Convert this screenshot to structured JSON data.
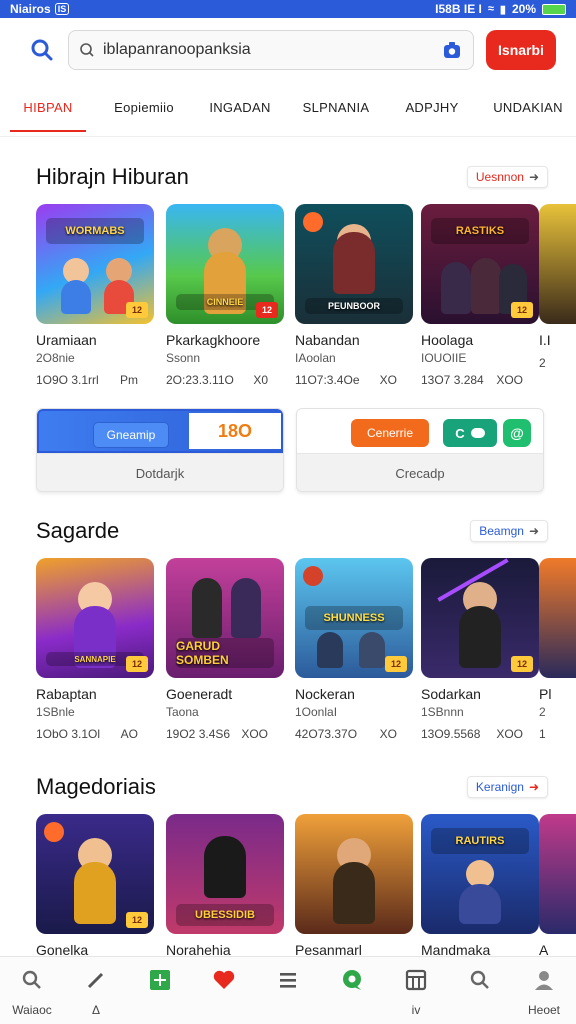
{
  "status_bar": {
    "left_text": "Niairos",
    "left_badge": "IS",
    "right_text": "I58B IE I",
    "battery_text": "20%"
  },
  "search": {
    "value": "iblapanranoopanksia",
    "button_label": "Isnarbi"
  },
  "tabs": [
    {
      "label": "HIBPAN",
      "active": true
    },
    {
      "label": "Eopiemiio",
      "active": false
    },
    {
      "label": "INGADAN",
      "active": false
    },
    {
      "label": "SLPNANIA",
      "active": false
    },
    {
      "label": "ADPJHY",
      "active": false
    },
    {
      "label": "UNDAKIAN",
      "active": false
    }
  ],
  "section1": {
    "title": "Hibrajn Hiburan",
    "see_all": "Uesnnon",
    "cards": [
      {
        "name": "Uramiaan",
        "sub": "2O8nie",
        "meta_left": "1O9O 3.1rrl",
        "meta_right": "Pm",
        "logo": "WORMABS",
        "badge": "12"
      },
      {
        "name": "Pkarkagkhoore",
        "sub": "Ssonn",
        "meta_left": "2O:23.3.11O",
        "meta_right": "X0",
        "logo": "CINNEIE",
        "badge": "12"
      },
      {
        "name": "Nabandan",
        "sub": "IAoolan",
        "meta_left": "11O7:3.4Oe",
        "meta_right": "XO",
        "logo": "PEUNBOOR",
        "badge": ""
      },
      {
        "name": "Hoolaga",
        "sub": "IOUOIIE",
        "meta_left": "13O7 3.284",
        "meta_right": "XOO",
        "logo": "RASTIKS",
        "badge": "12"
      },
      {
        "name": "I.I",
        "sub": "",
        "meta_left": "2",
        "meta_right": "",
        "logo": "",
        "badge": ""
      }
    ]
  },
  "promos": [
    {
      "button": "Gneamip",
      "value": "18O",
      "footer": "Dotdarjk"
    },
    {
      "button": "Cenerrie",
      "button2": "C",
      "icon": "@",
      "footer": "Crecadp"
    }
  ],
  "section2": {
    "title": "Sagarde",
    "see_all": "Beamgn",
    "cards": [
      {
        "name": "Rabaptan",
        "sub": "1SBnle",
        "meta_left": "1ObO 3.1Ol",
        "meta_right": "AO",
        "logo": "SANNAPIE",
        "badge": "12"
      },
      {
        "name": "Goeneradt",
        "sub": "Taona",
        "meta_left": "19O2 3.4S6",
        "meta_right": "XOO",
        "logo": "GARUD SOMBEN",
        "badge": ""
      },
      {
        "name": "Nockeran",
        "sub": "1OonlaI",
        "meta_left": "42O73.37O",
        "meta_right": "XO",
        "logo": "SHUNNESS",
        "badge": "12"
      },
      {
        "name": "Sodarkan",
        "sub": "1SBnnn",
        "meta_left": "13O9.5568",
        "meta_right": "XOO",
        "logo": "",
        "badge": "12"
      },
      {
        "name": "Pl",
        "sub": "2",
        "meta_left": "1",
        "meta_right": "",
        "logo": "",
        "badge": ""
      }
    ]
  },
  "section3": {
    "title": "Magedoriais",
    "see_all": "Keranign",
    "cards": [
      {
        "name": "Gonelka",
        "logo": "",
        "badge": "12"
      },
      {
        "name": "Norahehia",
        "logo": "UBESSIDIB",
        "badge": ""
      },
      {
        "name": "Pesanmarl",
        "logo": "",
        "badge": ""
      },
      {
        "name": "Mandmaka",
        "logo": "RAUTIRS",
        "badge": ""
      },
      {
        "name": "A",
        "logo": "",
        "badge": ""
      }
    ]
  },
  "bottom_nav": [
    {
      "label": "Waiaoc",
      "icon": "search-icon"
    },
    {
      "label": "Δ",
      "icon": "pen-icon"
    },
    {
      "label": "",
      "icon": "plus-square-icon"
    },
    {
      "label": "",
      "icon": "heart-icon"
    },
    {
      "label": "",
      "icon": "menu-icon"
    },
    {
      "label": "",
      "icon": "chat-icon"
    },
    {
      "label": "iv",
      "icon": "grid-icon"
    },
    {
      "label": "",
      "icon": "search-icon"
    },
    {
      "label": "Heoet",
      "icon": "user-icon"
    }
  ],
  "colors": {
    "accent_red": "#e8291e",
    "accent_blue": "#2b5bd9",
    "status_bar": "#2b5bd9"
  }
}
